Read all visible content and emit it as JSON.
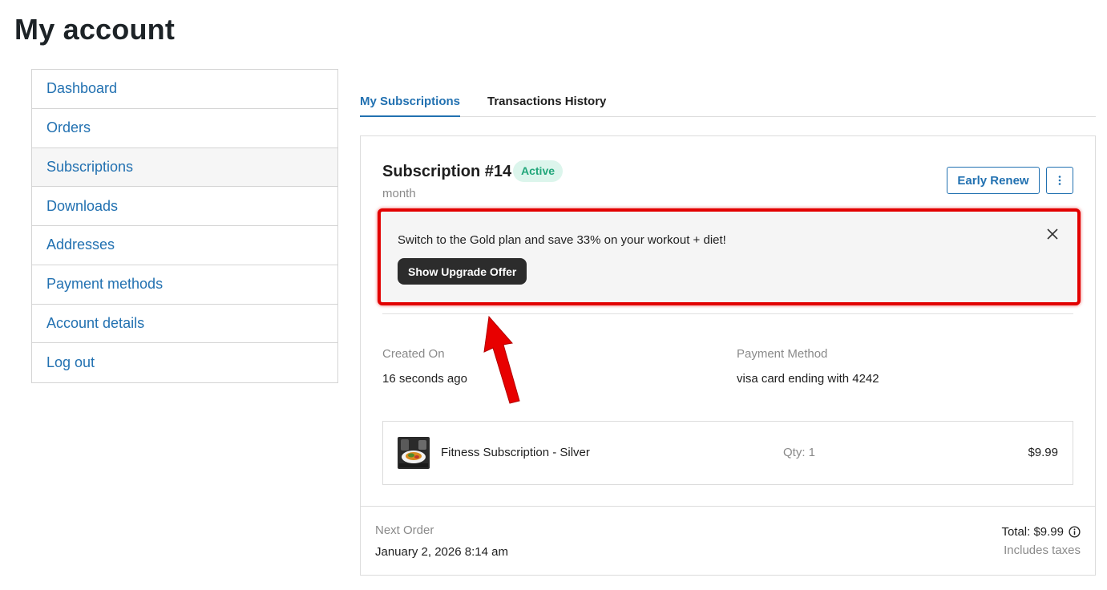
{
  "page": {
    "title": "My account"
  },
  "sidebar": {
    "items": [
      {
        "label": "Dashboard"
      },
      {
        "label": "Orders"
      },
      {
        "label": "Subscriptions",
        "active": true
      },
      {
        "label": "Downloads"
      },
      {
        "label": "Addresses"
      },
      {
        "label": "Payment methods"
      },
      {
        "label": "Account details"
      },
      {
        "label": "Log out"
      }
    ]
  },
  "tabs": [
    {
      "label": "My Subscriptions",
      "active": true
    },
    {
      "label": "Transactions History"
    }
  ],
  "subscription": {
    "title": "Subscription #14",
    "status": "Active",
    "period": "month",
    "early_renew_label": "Early Renew",
    "more_icon": "more-vertical-icon",
    "offer": {
      "text": "Switch to the Gold plan and save 33% on your workout + diet!",
      "button_label": "Show Upgrade Offer",
      "close_icon": "close-icon"
    },
    "created_on_label": "Created On",
    "created_on_value": "16 seconds ago",
    "payment_method_label": "Payment Method",
    "payment_method_value": "visa card ending with 4242",
    "item": {
      "name": "Fitness Subscription - Silver",
      "qty": "Qty: 1",
      "price": "$9.99"
    },
    "next_order_label": "Next Order",
    "next_order_value": "January 2, 2026 8:14 am",
    "total": "Total: $9.99",
    "includes_taxes": "Includes taxes"
  },
  "colors": {
    "link": "#2271b1",
    "badge_bg": "#dcf5ec",
    "badge_text": "#21a67a",
    "highlight": "#e20000"
  }
}
